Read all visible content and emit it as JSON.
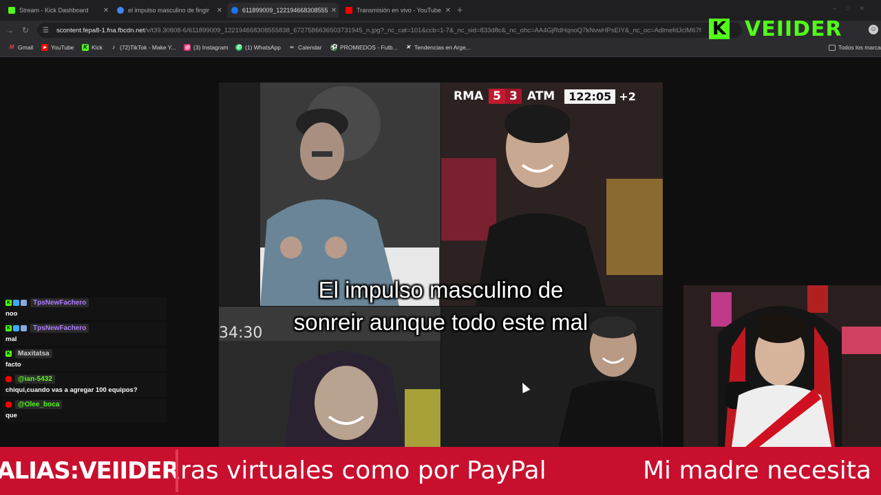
{
  "browser": {
    "tabs": [
      {
        "title": "Stream - Kick Dashboard",
        "favicon_color": "#53fc18",
        "active": false
      },
      {
        "title": "el impulso masculino de fingir",
        "favicon_color": "#4285f4",
        "active": false
      },
      {
        "title": "611899009_122194668308555",
        "favicon_color": "#1877f2",
        "active": true
      },
      {
        "title": "Transmisión en vivo - YouTube",
        "favicon_color": "#ff0000",
        "active": false
      }
    ],
    "new_tab_glyph": "+",
    "url_host": "scontent.fepa8-1.fna.fbcdn.net",
    "url_path": "/v/t39.30808-6/611899009_122194668308555838_6727586636503731945_n.jpg?_nc_cat=101&ccb=1-7&_nc_sid=833d8c&_nc_ohc=AA4GjRdHqnoQ7kNvwHPsEIY&_nc_oc=AdlmefdJcIM67f",
    "bookmarks": [
      {
        "label": "Gmail",
        "icon": "gmail-icon",
        "color": "#ea4335"
      },
      {
        "label": "YouTube",
        "icon": "youtube-icon",
        "color": "#ff0000"
      },
      {
        "label": "Kick",
        "icon": "kick-icon",
        "color": "#53fc18"
      },
      {
        "label": "(72)TikTok - Make Y...",
        "icon": "tiktok-icon",
        "color": "#ffffff"
      },
      {
        "label": "(3) Instagram",
        "icon": "instagram-icon",
        "color": "#e1306c"
      },
      {
        "label": "(1) WhatsApp",
        "icon": "whatsapp-icon",
        "color": "#25d366"
      },
      {
        "label": "Calendar",
        "icon": "calendar-icon",
        "color": "#cccccc"
      },
      {
        "label": "PROMIEDOS - Futb...",
        "icon": "promiedos-icon",
        "color": "#4caf50"
      },
      {
        "label": "Tendencias en Arge...",
        "icon": "x-icon",
        "color": "#ffffff"
      }
    ],
    "all_bookmarks": "Todos los marca"
  },
  "overlay": {
    "logo_letter": "K",
    "logo_name": "VEIIDER",
    "accent": "#53fc18"
  },
  "meme": {
    "caption_line1": "El impulso masculino de",
    "caption_line2": "sonreir aunque todo este mal",
    "scoreboard": {
      "home": "RMA",
      "home_score": "5",
      "away_score": "3",
      "away": "ATM",
      "time": "122:05",
      "added": "+2"
    },
    "p3_time": "34:30"
  },
  "chat": [
    {
      "user": "TpsNewFachero",
      "color": "#b07cff",
      "badges": [
        "kick-badge",
        "sub-badge",
        "og-badge"
      ],
      "text": "noo"
    },
    {
      "user": "TpsNewFachero",
      "color": "#b07cff",
      "badges": [
        "kick-badge",
        "sub-badge",
        "og-badge"
      ],
      "text": "mal"
    },
    {
      "user": "Maxitatsa",
      "color": "#cfcfcf",
      "badges": [
        "kick-badge"
      ],
      "text": "facto"
    },
    {
      "user": "@ian-5432",
      "color": "#53fc18",
      "badges": [
        "youtube-badge"
      ],
      "text": "chiqui,cuando vas a agregar 100 equipos?"
    },
    {
      "user": "@Olee_boca",
      "color": "#53fc18",
      "badges": [
        "youtube-badge"
      ],
      "text": "que"
    }
  ],
  "ticker": {
    "alias": "ALIAS:VEIIDER",
    "segment1": "ras virtuales como por PayPal",
    "segment2": "Mi madre necesita u",
    "bg": "#c8102e"
  }
}
